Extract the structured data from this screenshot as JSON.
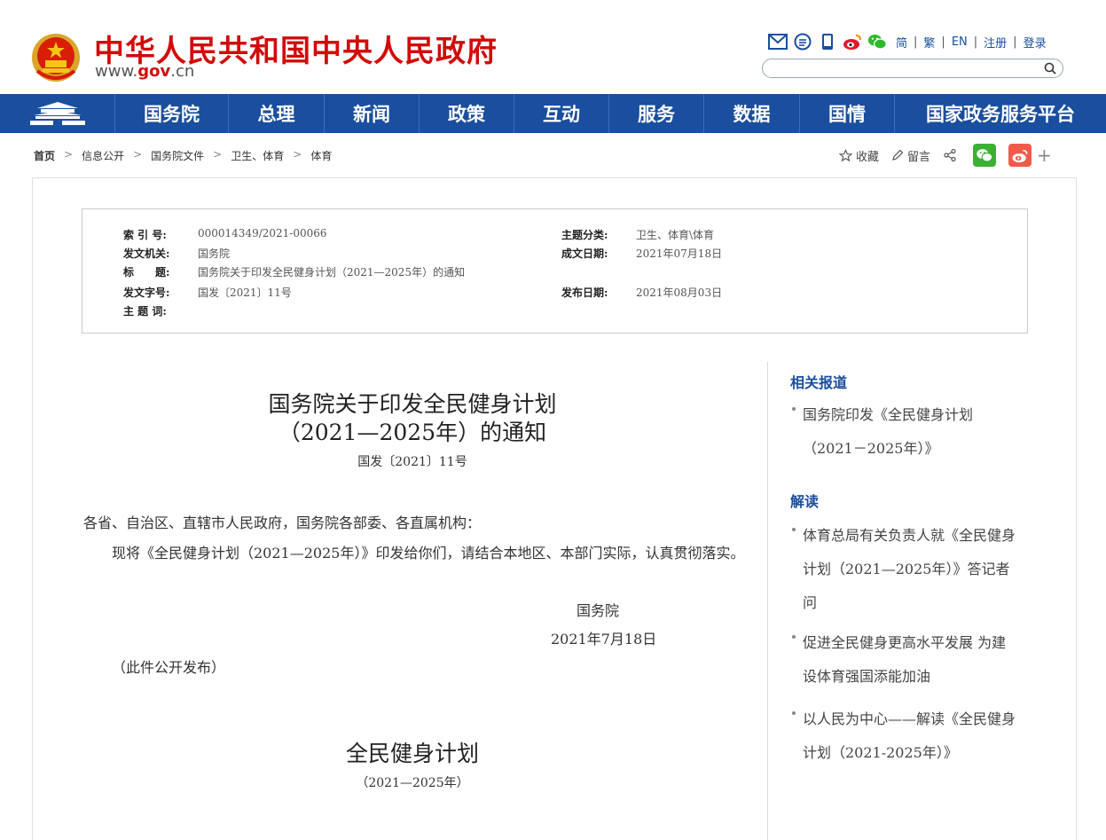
{
  "header": {
    "site_title": "中华人民共和国中央人民政府",
    "site_url_prefix": "www.",
    "site_url_domain": "gov",
    "site_url_suffix": ".cn",
    "tool_icons": [
      "mail-icon",
      "chat-icon",
      "mobile-icon",
      "weibo-icon",
      "wechat-icon"
    ],
    "lang_links": [
      "简",
      "繁",
      "EN",
      "注册",
      "登录"
    ],
    "search_placeholder": "",
    "accent_red": "#d20a0a"
  },
  "nav": {
    "items": [
      "国务院",
      "总理",
      "新闻",
      "政策",
      "互动",
      "服务",
      "数据",
      "国情",
      "国家政务服务平台"
    ],
    "background": "#1a4e9e"
  },
  "breadcrumb": {
    "items": [
      "首页",
      "信息公开",
      "国务院文件",
      "卫生、体育",
      "体育"
    ]
  },
  "share": {
    "favorite_label": "收藏",
    "comment_label": "留言",
    "more_label": "+"
  },
  "meta": {
    "index_label": "索 引 号:",
    "index_value": "000014349/2021-00066",
    "issuer_label": "发文机关:",
    "issuer_value": "国务院",
    "title_label": "标　　题:",
    "title_value": "国务院关于印发全民健身计划（2021—2025年）的通知",
    "doc_no_label": "发文字号:",
    "doc_no_value": "国发〔2021〕11号",
    "keywords_label": "主 题 词:",
    "keywords_value": "",
    "topic_label": "主题分类:",
    "topic_value": "卫生、体育\\体育",
    "written_label": "成文日期:",
    "written_value": "2021年07月18日",
    "published_label": "发布日期:",
    "published_value": "2021年08月03日"
  },
  "article": {
    "title_line1": "国务院关于印发全民健身计划",
    "title_line2": "（2021—2025年）的通知",
    "doc_no": "国发〔2021〕11号",
    "addressee": "各省、自治区、直辖市人民政府，国务院各部委、各直属机构：",
    "body": "现将《全民健身计划（2021—2025年）》印发给你们，请结合本地区、本部门实际，认真贯彻落实。",
    "signer": "国务院",
    "sign_date": "2021年7月18日",
    "public_note": "（此件公开发布）",
    "plan_title": "全民健身计划",
    "plan_years": "（2021—2025年）"
  },
  "sidebar": {
    "related_heading": "相关报道",
    "related_links": [
      "国务院印发《全民健身计划（2021－2025年）》"
    ],
    "interpret_heading": "解读",
    "interpret_links": [
      "体育总局有关负责人就《全民健身计划（2021—2025年）》答记者问",
      "促进全民健身更高水平发展 为建设体育强国添能加油",
      "以人民为中心——解读《全民健身计划（2021-2025年）》"
    ]
  }
}
